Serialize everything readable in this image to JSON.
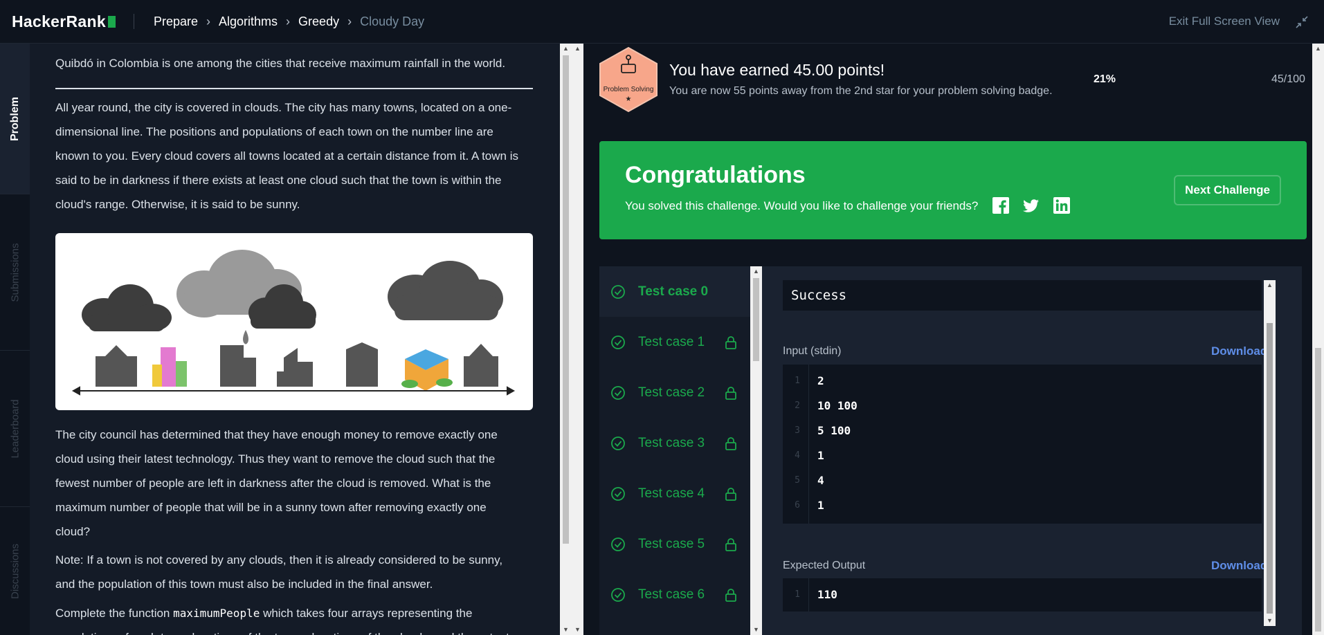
{
  "header": {
    "logo": "HackerRank",
    "breadcrumbs": [
      {
        "label": "Prepare"
      },
      {
        "label": "Algorithms"
      },
      {
        "label": "Greedy"
      },
      {
        "label": "Cloudy Day"
      }
    ],
    "exit_label": "Exit Full Screen View"
  },
  "rail": {
    "tabs": [
      {
        "label": "Problem",
        "active": true
      },
      {
        "label": "Submissions",
        "active": false
      },
      {
        "label": "Leaderboard",
        "active": false
      },
      {
        "label": "Discussions",
        "active": false
      }
    ]
  },
  "problem": {
    "p1": "Quibdó in Colombia is one among the cities that receive maximum rainfall in the world.",
    "p2_lines": [
      "All year round, the city is covered in clouds. The city has many towns, located on a one-",
      "dimensional line. The positions and populations of each town on the number line are",
      "known to you. Every cloud covers all towns located at a certain distance from it. A town is",
      "said to be in darkness if there exists at least one cloud such that the town is within the",
      "cloud's range. Otherwise, it is said to be sunny."
    ],
    "p3_lines": [
      "The city council has determined that they have enough money to remove exactly one",
      "cloud using their latest technology. Thus they want to remove the cloud such that the",
      "fewest number of people are left in darkness after the cloud is removed. What is the",
      "maximum number of people that will be in a sunny town after removing exactly one",
      "cloud?"
    ],
    "p4_lines": [
      "Note: If a town is not covered by any clouds, then it is already considered to be sunny,",
      "and the population of this town must also be included in the final answer."
    ],
    "p5_pre": "Complete the function ",
    "p5_code": "maximumPeople",
    "p5_post": " which takes four arrays representing the",
    "p6_partial": "populations of each town, locations of the towns, locations of the clouds, and the extent"
  },
  "achievement": {
    "badge_label": "Problem Solving",
    "badge_stars": "★",
    "title": "You have earned 45.00 points!",
    "subtitle": "You are now 55 points away from the 2nd star for your problem solving badge.",
    "percent": "21%",
    "progress": "45/100"
  },
  "congrats": {
    "title": "Congratulations",
    "subtitle": "You solved this challenge. Would you like to challenge your friends?",
    "next_button": "Next Challenge",
    "share_icons": [
      "facebook-icon",
      "twitter-icon",
      "linkedin-icon"
    ]
  },
  "testcases": [
    {
      "label": "Test case 0",
      "active": true,
      "locked": false
    },
    {
      "label": "Test case 1",
      "active": false,
      "locked": true
    },
    {
      "label": "Test case 2",
      "active": false,
      "locked": true
    },
    {
      "label": "Test case 3",
      "active": false,
      "locked": true
    },
    {
      "label": "Test case 4",
      "active": false,
      "locked": true
    },
    {
      "label": "Test case 5",
      "active": false,
      "locked": true
    },
    {
      "label": "Test case 6",
      "active": false,
      "locked": true
    }
  ],
  "result": {
    "status": "Success",
    "input_label": "Input (stdin)",
    "download_label": "Download",
    "input_lines": [
      "2",
      "10 100",
      "5 100",
      "1",
      "4",
      "1"
    ],
    "output_label": "Expected Output",
    "output_lines": [
      "110"
    ]
  },
  "colors": {
    "accent_green": "#1ba94c",
    "link_blue": "#5f8ee8",
    "bg_dark": "#0e141e"
  }
}
